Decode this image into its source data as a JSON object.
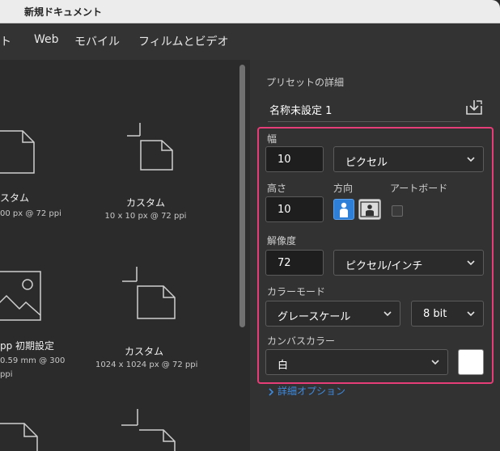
{
  "window": {
    "title": "新規ドキュメント"
  },
  "tabs": [
    {
      "label": "ト"
    },
    {
      "label": "Web"
    },
    {
      "label": "モバイル"
    },
    {
      "label": "フィルムとビデオ"
    }
  ],
  "presets": [
    {
      "label": "スタム",
      "sub1": "00 px @ 72 ppi",
      "sub2": ""
    },
    {
      "label": "カスタム",
      "sub1": "10 x 10 px @ 72 ppi",
      "sub2": ""
    },
    {
      "label": "pp 初期設定",
      "sub1": "0.59 mm @ 300",
      "sub2": "ppi"
    },
    {
      "label": "カスタム",
      "sub1": "1024 x 1024 px @ 72 ppi",
      "sub2": ""
    }
  ],
  "details": {
    "heading": "プリセットの詳細",
    "name": "名称未設定 1",
    "width_label": "幅",
    "width_value": "10",
    "width_unit": "ピクセル",
    "height_label": "高さ",
    "height_value": "10",
    "orientation_label": "方向",
    "artboard_label": "アートボード",
    "resolution_label": "解像度",
    "resolution_value": "72",
    "resolution_unit": "ピクセル/インチ",
    "color_mode_label": "カラーモード",
    "color_mode_value": "グレースケール",
    "bit_depth_value": "8 bit",
    "canvas_color_label": "カンバスカラー",
    "canvas_color_value": "白",
    "advanced_options": "詳細オプション"
  },
  "colors": {
    "highlight": "#e63c78",
    "accent": "#2d7fd8",
    "link": "#3d8be0",
    "canvas_swatch": "#ffffff"
  }
}
